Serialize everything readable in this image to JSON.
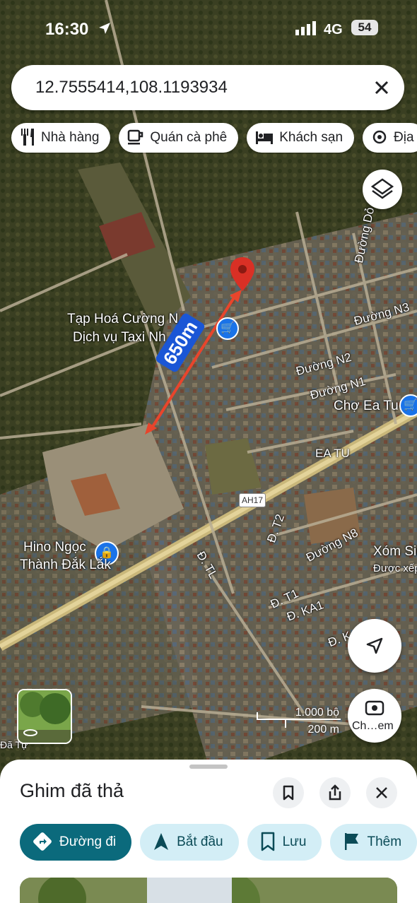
{
  "status_bar": {
    "time": "16:30",
    "network": "4G",
    "battery": "54"
  },
  "search": {
    "query": "12.7555414,108.1193934"
  },
  "chips": [
    {
      "label": "Nhà hàng",
      "icon": "restaurant-icon"
    },
    {
      "label": "Quán cà phê",
      "icon": "coffee-icon"
    },
    {
      "label": "Khách sạn",
      "icon": "hotel-icon"
    },
    {
      "label": "Địa",
      "icon": "attraction-icon"
    }
  ],
  "map": {
    "distance_badge": "650m",
    "labels": {
      "shop1_line1": "Tạp Hoá Cường N",
      "shop1_line2": "Dịch vụ Taxi Nh",
      "road_do": "Đường Dỏ",
      "road_n3": "Đường N3",
      "road_n2": "Đường N2",
      "road_n1": "Đường N1",
      "market": "Chợ Ea Tu",
      "ea_tu": "EA TU",
      "ah17": "AH17",
      "d_t2": "Đ. T2",
      "road_n8": "Đường N8",
      "hino_line1": "Hino Ngọc",
      "hino_line2": "Thành Đắk Lắk",
      "d_tl": "Đ. TL",
      "xom_line1": "Xóm Sin",
      "xom_line2": "Được xếp",
      "d_t1": "Đ. T1",
      "d_ka1": "Đ. KA1",
      "d_k": "Đ. K",
      "da_tu": "Đã Tự",
      "bottom_n": "Đ. K"
    },
    "scale": {
      "top": "1.000 bộ",
      "bottom": "200 m"
    },
    "camera_label": "Ch…em"
  },
  "sheet": {
    "title": "Ghim đã thả",
    "actions": [
      {
        "label": "Đường đi",
        "icon": "directions-icon",
        "primary": true
      },
      {
        "label": "Bắt đầu",
        "icon": "navigation-arrow-icon",
        "primary": false
      },
      {
        "label": "Lưu",
        "icon": "bookmark-icon",
        "primary": false
      },
      {
        "label": "Thêm",
        "icon": "flag-icon",
        "primary": false
      }
    ]
  },
  "colors": {
    "primary_action": "#0b6a7c",
    "secondary_action": "#d3eef6",
    "pin": "#d93025",
    "measure_line": "#e8452c",
    "badge": "#1a56d6"
  }
}
